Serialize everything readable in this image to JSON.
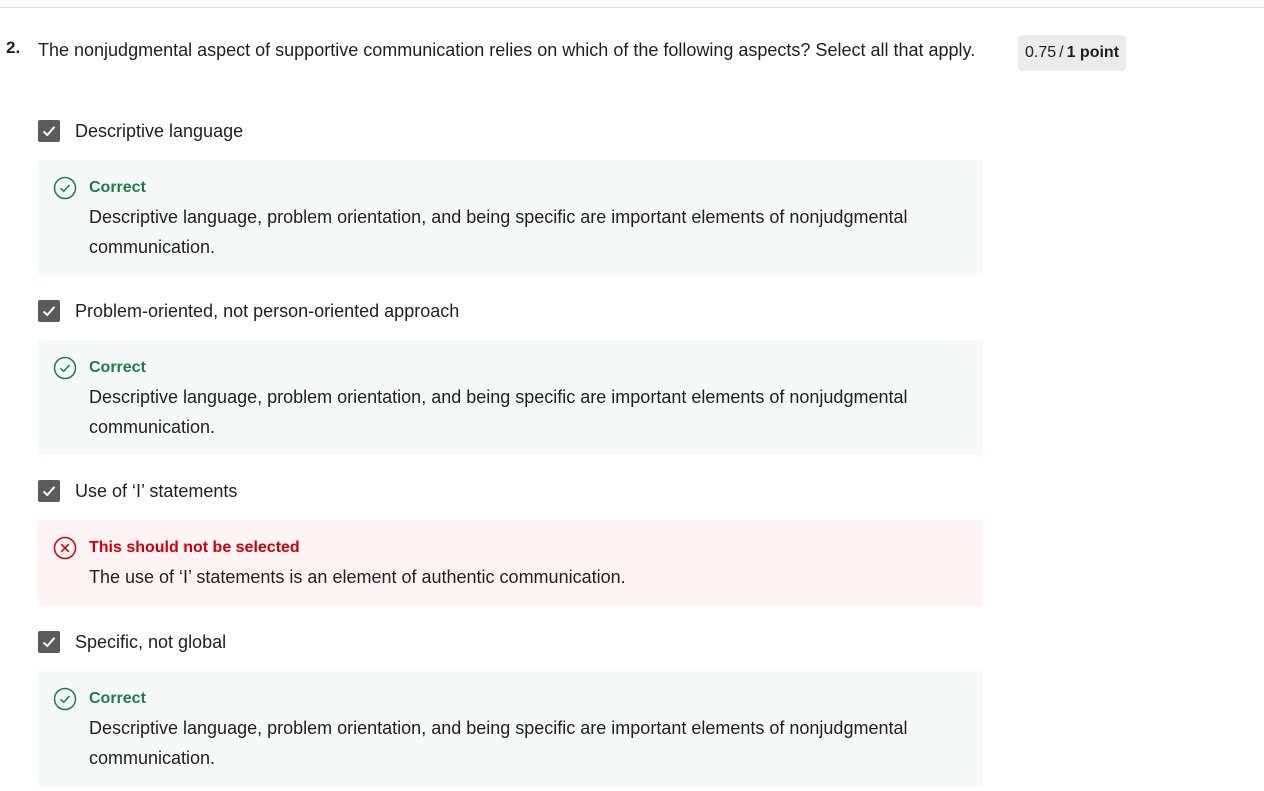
{
  "question": {
    "number": "2.",
    "text": "The nonjudgmental aspect of supportive communication relies on which of the following aspects? Select all that apply."
  },
  "score": {
    "value": "0.75",
    "separator": "/",
    "total": "1 point"
  },
  "options": [
    {
      "label": "Descriptive language",
      "checked": true,
      "feedback": {
        "status": "correct",
        "title": "Correct",
        "text": "Descriptive language, problem orientation, and being specific are important elements of nonjudgmental communication."
      }
    },
    {
      "label": "Problem-oriented, not person-oriented approach",
      "checked": true,
      "feedback": {
        "status": "correct",
        "title": "Correct",
        "text": "Descriptive language, problem orientation, and being specific are important elements of nonjudgmental communication."
      }
    },
    {
      "label": "Use of ‘I’ statements",
      "checked": true,
      "feedback": {
        "status": "incorrect",
        "title": "This should not be selected",
        "text": "The use of ‘I’ statements is an element of authentic communication."
      }
    },
    {
      "label": "Specific, not global",
      "checked": true,
      "feedback": {
        "status": "correct",
        "title": "Correct",
        "text": "Descriptive language, problem orientation, and being specific are important elements of nonjudgmental communication."
      }
    }
  ],
  "colors": {
    "correct": "#1e7b4c",
    "incorrect": "#c8000f",
    "checkbox": "#5b5b5b"
  },
  "icons": {
    "checkbox": "checkmark-icon",
    "correct": "check-circle-icon",
    "incorrect": "x-circle-icon"
  }
}
